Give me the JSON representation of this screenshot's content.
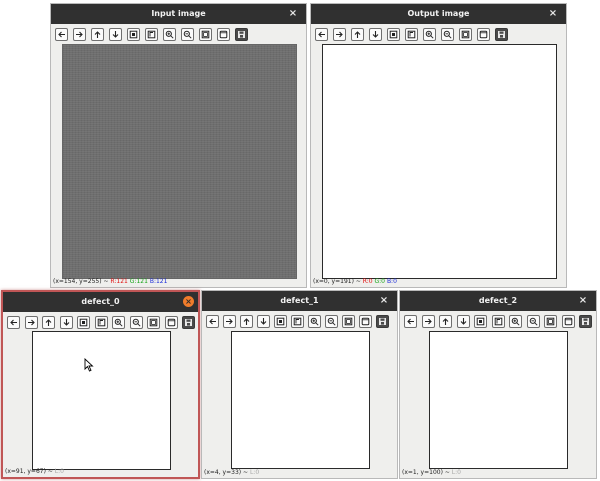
{
  "windows": {
    "input": {
      "title": "Input image",
      "close": "×",
      "status": {
        "coord": "(x=154, y=255) ~ ",
        "r": "R:121",
        "g": "G:121",
        "b": "B:121"
      }
    },
    "output": {
      "title": "Output image",
      "close": "×",
      "status": {
        "coord": "(x=0, y=191) ~ ",
        "r": "R:0",
        "g": "G:0",
        "b": "B:0"
      }
    },
    "defect_0": {
      "title": "defect_0",
      "close": "×",
      "status": {
        "coord": "(x=91, y=67) ~ ",
        "l": "L:0"
      }
    },
    "defect_1": {
      "title": "defect_1",
      "close": "×",
      "status": {
        "coord": "(x=4, y=33) ~ ",
        "l": "L:0"
      }
    },
    "defect_2": {
      "title": "defect_2",
      "close": "×",
      "status": {
        "coord": "(x=1, y=100) ~ ",
        "l": "L:0"
      }
    }
  },
  "toolbar_icons": [
    "pan-left-icon",
    "pan-right-icon",
    "pan-up-icon",
    "pan-down-icon",
    "zoom-fit-icon",
    "zoom-actual-icon",
    "zoom-in-icon",
    "zoom-out-icon",
    "copy-image-icon",
    "properties-icon",
    "save-icon"
  ],
  "colors": {
    "titlebar": "#303030",
    "active_border": "#c05656",
    "close_active": "#f07c2b",
    "image_gray": "#6e6e6e"
  }
}
